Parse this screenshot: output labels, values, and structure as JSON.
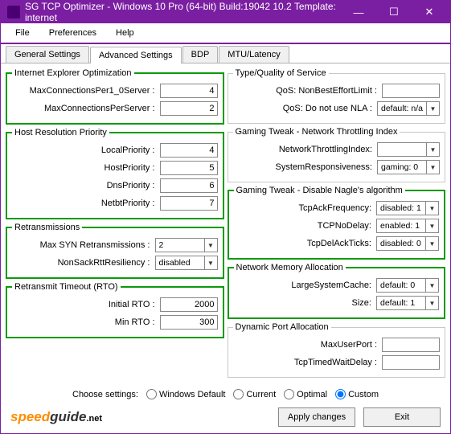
{
  "title": "SG TCP Optimizer - Windows 10 Pro (64-bit) Build:19042 10.2  Template: internet",
  "menu": {
    "file": "File",
    "prefs": "Preferences",
    "help": "Help"
  },
  "tabs": {
    "general": "General Settings",
    "advanced": "Advanced Settings",
    "bdp": "BDP",
    "mtu": "MTU/Latency"
  },
  "ie": {
    "legend": "Internet Explorer Optimization",
    "maxPer10": {
      "label": "MaxConnectionsPer1_0Server :",
      "value": "4"
    },
    "maxPerSrv": {
      "label": "MaxConnectionsPerServer :",
      "value": "2"
    }
  },
  "hrp": {
    "legend": "Host Resolution Priority",
    "local": {
      "label": "LocalPriority :",
      "value": "4"
    },
    "host": {
      "label": "HostPriority :",
      "value": "5"
    },
    "dns": {
      "label": "DnsPriority :",
      "value": "6"
    },
    "netbt": {
      "label": "NetbtPriority :",
      "value": "7"
    }
  },
  "ret": {
    "legend": "Retransmissions",
    "maxsyn": {
      "label": "Max SYN Retransmissions :",
      "value": "2"
    },
    "nonsack": {
      "label": "NonSackRttResiliency :",
      "value": "disabled"
    }
  },
  "rto": {
    "legend": "Retransmit Timeout (RTO)",
    "initial": {
      "label": "Initial RTO :",
      "value": "2000"
    },
    "min": {
      "label": "Min RTO :",
      "value": "300"
    }
  },
  "qos": {
    "legend": "Type/Quality of Service",
    "nbe": {
      "label": "QoS: NonBestEffortLimit :",
      "value": ""
    },
    "nla": {
      "label": "QoS: Do not use NLA :",
      "value": "default: n/a"
    }
  },
  "gt1": {
    "legend": "Gaming Tweak - Network Throttling Index",
    "nti": {
      "label": "NetworkThrottlingIndex:",
      "value": ""
    },
    "sr": {
      "label": "SystemResponsiveness:",
      "value": "gaming: 0"
    }
  },
  "gt2": {
    "legend": "Gaming Tweak - Disable Nagle's algorithm",
    "taf": {
      "label": "TcpAckFrequency:",
      "value": "disabled: 1"
    },
    "tnd": {
      "label": "TCPNoDelay:",
      "value": "enabled: 1"
    },
    "tdat": {
      "label": "TcpDelAckTicks:",
      "value": "disabled: 0"
    }
  },
  "nma": {
    "legend": "Network Memory Allocation",
    "lsc": {
      "label": "LargeSystemCache:",
      "value": "default: 0"
    },
    "size": {
      "label": "Size:",
      "value": "default: 1"
    }
  },
  "dpa": {
    "legend": "Dynamic Port Allocation",
    "mup": {
      "label": "MaxUserPort :",
      "value": ""
    },
    "ttwd": {
      "label": "TcpTimedWaitDelay :",
      "value": ""
    }
  },
  "choose": {
    "label": "Choose settings:",
    "wd": "Windows Default",
    "cur": "Current",
    "opt": "Optimal",
    "cus": "Custom"
  },
  "btn": {
    "apply": "Apply changes",
    "exit": "Exit"
  },
  "logo": {
    "p1": "speed",
    "p2": "guide",
    "p3": ".net"
  }
}
